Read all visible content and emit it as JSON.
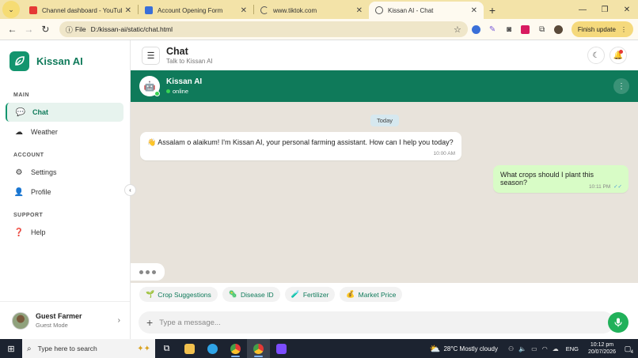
{
  "browser": {
    "tabs": [
      {
        "title": "Channel dashboard - YouTube S",
        "favicon_color": "#e53935"
      },
      {
        "title": "Account Opening Form",
        "favicon_color": "#3a6fd8"
      },
      {
        "title": "www.tiktok.com",
        "favicon_color": "#555555"
      },
      {
        "title": "Kissan AI - Chat",
        "favicon_color": "#555555"
      }
    ],
    "active_tab_index": 3,
    "address": {
      "scheme_label": "File",
      "url": "D:/kissan-ai/static/chat.html"
    },
    "finish_update_label": "Finish update"
  },
  "sidebar": {
    "brand_name": "Kissan AI",
    "sections": {
      "main": "MAIN",
      "account": "ACCOUNT",
      "support": "SUPPORT"
    },
    "items": {
      "chat": "Chat",
      "weather": "Weather",
      "settings": "Settings",
      "profile": "Profile",
      "help": "Help"
    },
    "user": {
      "name": "Guest Farmer",
      "mode": "Guest Mode"
    }
  },
  "header": {
    "title": "Chat",
    "subtitle": "Talk to Kissan AI"
  },
  "chat": {
    "bot_name": "Kissan AI",
    "status": "online",
    "day_label": "Today",
    "messages": [
      {
        "direction": "in",
        "emoji": "👋",
        "text": "Assalam o alaikum! I'm Kissan AI, your personal farming assistant. How can I help you today?",
        "time": "10:00 AM"
      },
      {
        "direction": "out",
        "text": "What crops should I plant this season?",
        "time": "10:11 PM"
      }
    ],
    "quick_replies": [
      {
        "icon": "🌱",
        "label": "Crop Suggestions"
      },
      {
        "icon": "🦠",
        "label": "Disease ID"
      },
      {
        "icon": "🧪",
        "label": "Fertilizer"
      },
      {
        "icon": "💰",
        "label": "Market Price"
      }
    ],
    "input_placeholder": "Type a message..."
  },
  "taskbar": {
    "search_placeholder": "Type here to search",
    "weather": "28°C  Mostly cloudy",
    "language": "ENG",
    "time": "10:12 pm",
    "date": "20/07/2026",
    "notification_count": "4"
  },
  "colors": {
    "brand": "#13956e",
    "header_green": "#0f7a5a",
    "outgoing_bubble": "#d8fcc6",
    "chat_background": "#e8e3db",
    "mic_button": "#21b15a"
  }
}
